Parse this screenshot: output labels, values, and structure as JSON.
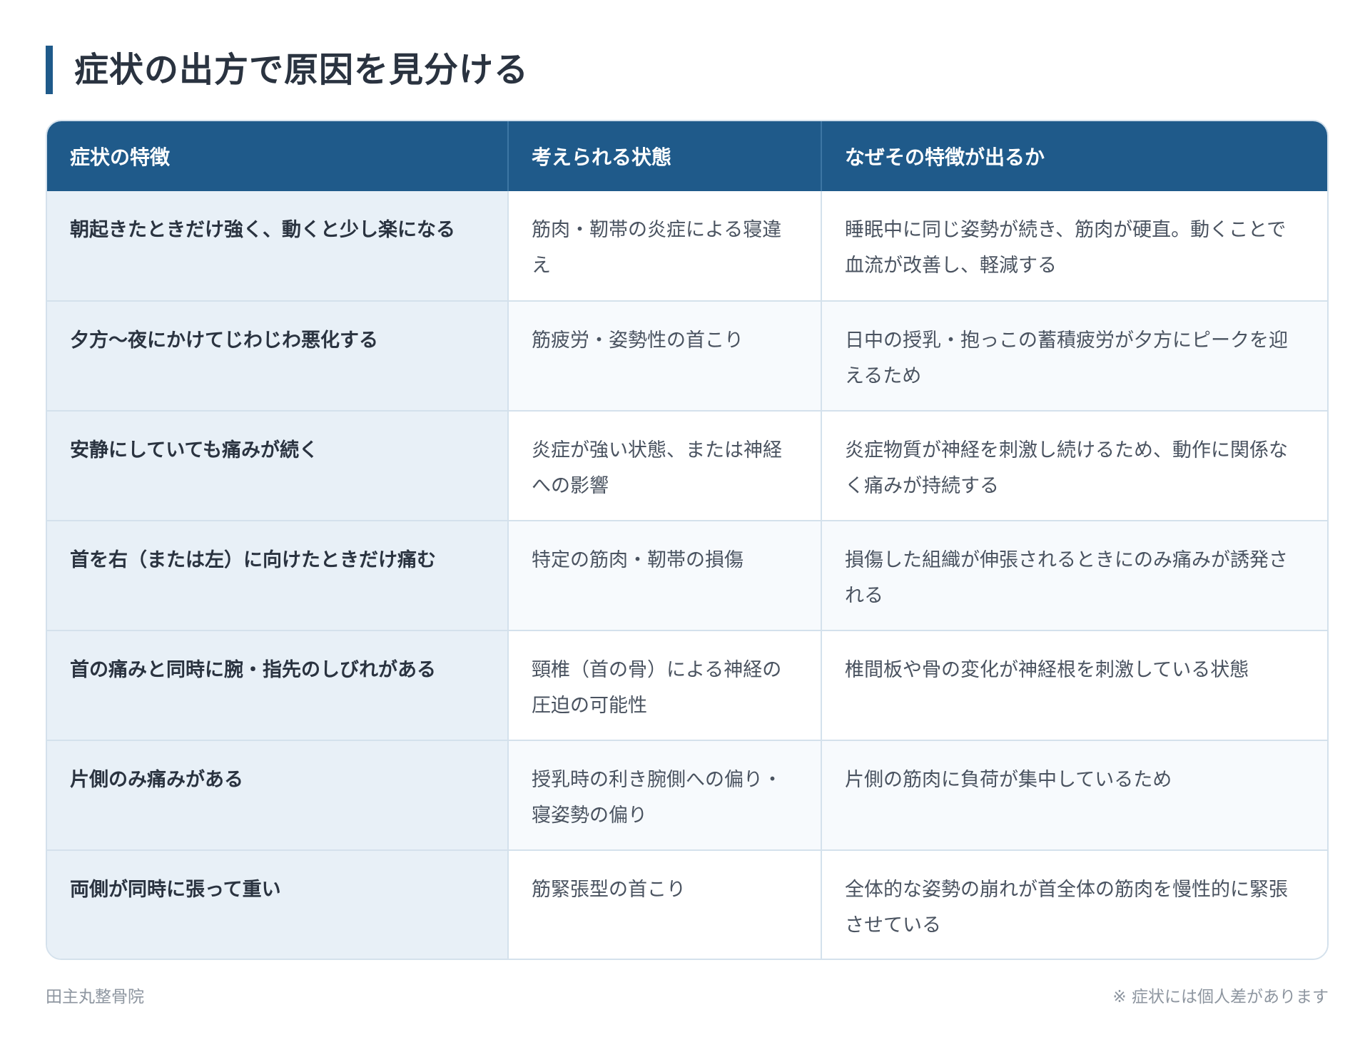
{
  "title": "症状の出方で原因を見分ける",
  "table": {
    "headers": [
      "症状の特徴",
      "考えられる状態",
      "なぜその特徴が出るか"
    ],
    "rows": [
      {
        "feature": "朝起きたときだけ強く、動くと少し楽になる",
        "condition": "筋肉・靭帯の炎症による寝違え",
        "reason": "睡眠中に同じ姿勢が続き、筋肉が硬直。動くことで血流が改善し、軽減する"
      },
      {
        "feature": "夕方〜夜にかけてじわじわ悪化する",
        "condition": "筋疲労・姿勢性の首こり",
        "reason": "日中の授乳・抱っこの蓄積疲労が夕方にピークを迎えるため"
      },
      {
        "feature": "安静にしていても痛みが続く",
        "condition": "炎症が強い状態、または神経への影響",
        "reason": "炎症物質が神経を刺激し続けるため、動作に関係なく痛みが持続する"
      },
      {
        "feature": "首を右（または左）に向けたときだけ痛む",
        "condition": "特定の筋肉・靭帯の損傷",
        "reason": "損傷した組織が伸張されるときにのみ痛みが誘発される"
      },
      {
        "feature": "首の痛みと同時に腕・指先のしびれがある",
        "condition": "頸椎（首の骨）による神経の圧迫の可能性",
        "reason": "椎間板や骨の変化が神経根を刺激している状態"
      },
      {
        "feature": "片側のみ痛みがある",
        "condition": "授乳時の利き腕側への偏り・寝姿勢の偏り",
        "reason": "片側の筋肉に負荷が集中しているため"
      },
      {
        "feature": "両側が同時に張って重い",
        "condition": "筋緊張型の首こり",
        "reason": "全体的な姿勢の崩れが首全体の筋肉を慢性的に緊張させている"
      }
    ]
  },
  "footer": {
    "clinic": "田主丸整骨院",
    "note": "※ 症状には個人差があります"
  },
  "colors": {
    "accent": "#1f5a8a",
    "feature_bg": "#e8f0f7",
    "border": "#d4e1ec"
  }
}
